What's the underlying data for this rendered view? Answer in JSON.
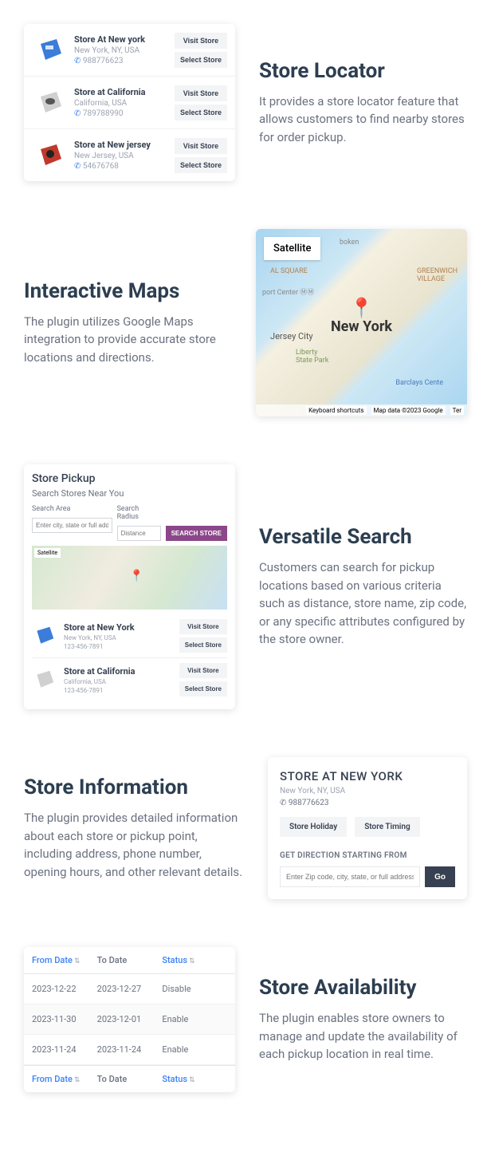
{
  "sec1": {
    "title": "Store Locator",
    "desc": "It provides a store locator feature that allows customers to find nearby stores for order pickup.",
    "stores": [
      {
        "name": "Store At New york",
        "loc": "New York, NY, USA",
        "phone": "988776623"
      },
      {
        "name": "Store at California",
        "loc": "California, USA",
        "phone": "789788990"
      },
      {
        "name": "Store at New jersey",
        "loc": "New Jersey, USA",
        "phone": "54676768"
      }
    ],
    "visit": "Visit Store",
    "select": "Select Store"
  },
  "sec2": {
    "title": "Interactive Maps",
    "desc": "The plugin utilizes Google Maps integration to provide accurate store locations and directions.",
    "satellite": "Satellite",
    "city": "New York",
    "foot": {
      "a": "Keyboard shortcuts",
      "b": "Map data ©2023 Google",
      "c": "Ter"
    }
  },
  "sec3": {
    "title": "Versatile Search",
    "desc": "Customers can search for pickup locations based on various criteria such as distance, store name, zip code, or any specific attributes configured by the store owner.",
    "card": {
      "title": "Store Pickup",
      "sub": "Search Stores Near You",
      "area_lbl": "Search Area",
      "radius_lbl": "Search Radius",
      "area_ph": "Enter city, state or full address",
      "radius_ph": "Distance",
      "btn": "SEARCH STORE"
    },
    "stores": [
      {
        "name": "Store at New York",
        "loc": "New York, NY, USA",
        "phone": "123-456-7891"
      },
      {
        "name": "Store at California",
        "loc": "California, USA",
        "phone": "123-456-7891"
      }
    ],
    "visit": "Visit Store",
    "select": "Select Store"
  },
  "sec4": {
    "title": "Store Information",
    "desc": "The plugin provides detailed information about each store or pickup point, including address, phone number, opening hours, and other relevant details.",
    "card": {
      "title": "STORE AT NEW YORK",
      "loc": "New York, NY, USA",
      "phone": "988776623",
      "tab1": "Store Holiday",
      "tab2": "Store Timing",
      "dir": "GET DIRECTION STARTING FROM",
      "ph": "Enter Zip code, city, state, or full address",
      "go": "Go"
    }
  },
  "sec5": {
    "title": "Store Availability",
    "desc": "The plugin enables store owners to manage and update the availability of each pickup location in real time.",
    "head": {
      "from": "From Date",
      "to": "To Date",
      "status": "Status"
    },
    "rows": [
      {
        "from": "2023-12-22",
        "to": "2023-12-27",
        "status": "Disable"
      },
      {
        "from": "2023-11-30",
        "to": "2023-12-01",
        "status": "Enable"
      },
      {
        "from": "2023-11-24",
        "to": "2023-11-24",
        "status": "Enable"
      }
    ]
  }
}
